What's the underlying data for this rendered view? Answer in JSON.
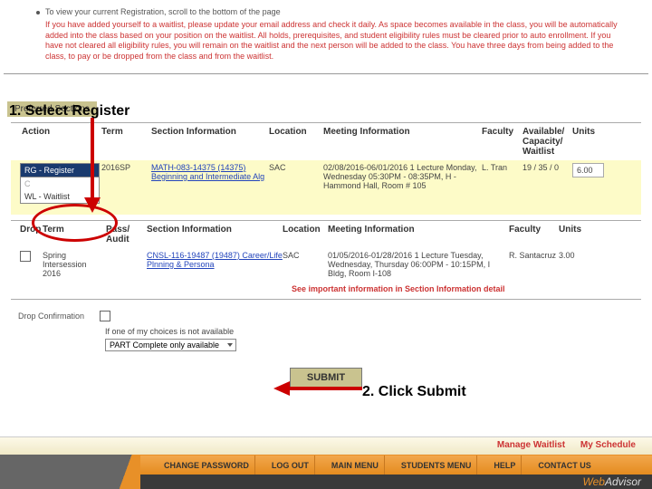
{
  "intro": {
    "bullet1": "To view your current Registration, scroll to the bottom of the page",
    "waitlist_notice": "If you have added yourself to a waitlist, please update your email address and check it daily. As space becomes available in the class, you will be automatically added into the class based on your position on the waitlist. All holds, prerequisites, and student eligibility rules must be cleared prior to auto enrollment. If you have not cleared all eligibility rules, you will remain on the waitlist and the next person will be added to the class. You have three days from being added to the class, to pay or be dropped from the class and from the waitlist."
  },
  "callouts": {
    "step1": "1. Select  Register",
    "step2": "2. Click Submit"
  },
  "preferred_sections_label": "Preferred Sections",
  "table1": {
    "headers": {
      "action": "Action",
      "term": "Term",
      "section": "Section Information",
      "location": "Location",
      "meeting": "Meeting Information",
      "faculty": "Faculty",
      "avail": "Available/ Capacity/ Waitlist",
      "units": "Units"
    },
    "row": {
      "selected_action": "RG - Register",
      "option_waitlist": "WL - Waitlist",
      "term": "2016SP",
      "section_line1": "MATH-083-14375 (14375)",
      "section_line2": "Beginning and Intermediate Alg",
      "location": "SAC",
      "meeting": "02/08/2016-06/01/2016 1 Lecture Monday, Wednesday 05:30PM - 08:35PM, H - Hammond Hall, Room # 105",
      "faculty": "L. Tran",
      "avail": "19 / 35 / 0",
      "units": "6.00"
    }
  },
  "table2": {
    "headers": {
      "drop": "Drop",
      "term": "Term",
      "pass": "Pass/ Audit",
      "section": "Section Information",
      "location": "Location",
      "meeting": "Meeting Information",
      "faculty": "Faculty",
      "units": "Units"
    },
    "row": {
      "term": "Spring Intersession 2016",
      "section": "CNSL-116-19487 (19487) Career/Life Plnning & Persona",
      "location": "SAC",
      "meeting": "01/05/2016-01/28/2016 1 Lecture Tuesday, Wednesday, Thursday 06:00PM - 10:15PM, I Bldg, Room I-108",
      "faculty": "R. Santacruz",
      "units": "3.00"
    },
    "important": "See important information in Section Information detail"
  },
  "drop_confirmation_label": "Drop Confirmation",
  "part_label": "If one of my choices is not available",
  "part_select_value": "PART Complete only available",
  "submit_label": "SUBMIT",
  "footer_links": {
    "manage": "Manage Waitlist",
    "schedule": "My Schedule"
  },
  "nav": {
    "change_pw": "CHANGE PASSWORD",
    "logout": "LOG OUT",
    "main": "MAIN MENU",
    "students": "STUDENTS MENU",
    "help": "HELP",
    "contact": "CONTACT US"
  },
  "logo": {
    "web": "Web",
    "advisor": "Advisor"
  }
}
